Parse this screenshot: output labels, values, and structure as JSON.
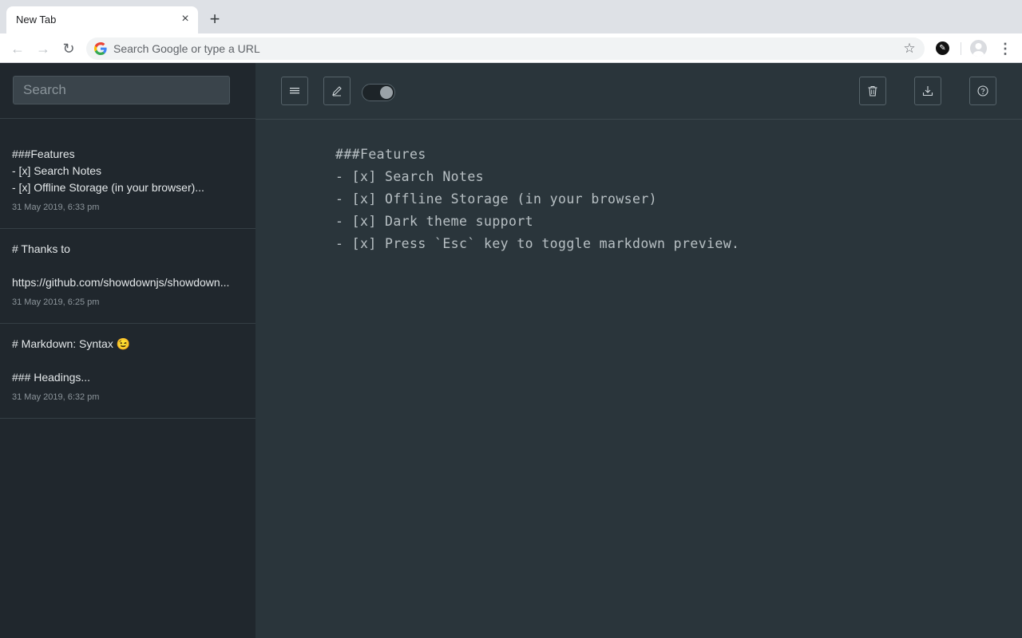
{
  "browser": {
    "tab_title": "New Tab",
    "tab_close": "×",
    "new_tab": "+",
    "omnibox_placeholder": "Search Google or type a URL"
  },
  "sidebar": {
    "search_placeholder": "Search",
    "notes": [
      {
        "lines": [
          "###Features",
          "- [x] Search Notes",
          "- [x] Offline Storage (in your browser)..."
        ],
        "date": "31 May 2019, 6:33 pm"
      },
      {
        "lines": [
          "# Thanks to",
          "",
          "https://github.com/showdownjs/showdown..."
        ],
        "date": "31 May 2019, 6:25 pm"
      },
      {
        "lines": [
          "# Markdown: Syntax 😉",
          "",
          "### Headings..."
        ],
        "date": "31 May 2019, 6:32 pm"
      }
    ]
  },
  "editor": {
    "lines": [
      "###Features",
      "- [x] Search Notes",
      "- [x] Offline Storage (in your browser)",
      "- [x] Dark theme support",
      "- [x] Press `Esc` key to toggle markdown preview."
    ]
  },
  "toolbar": {
    "toggle_on": true
  },
  "icons": {
    "menu": "hamburger-icon",
    "edit": "pencil-icon",
    "delete": "trash-icon",
    "download": "download-icon",
    "help": "help-icon"
  },
  "colors": {
    "sidebar_bg": "#20272d",
    "main_bg": "#2a353b",
    "text": "#b8c0c4"
  }
}
